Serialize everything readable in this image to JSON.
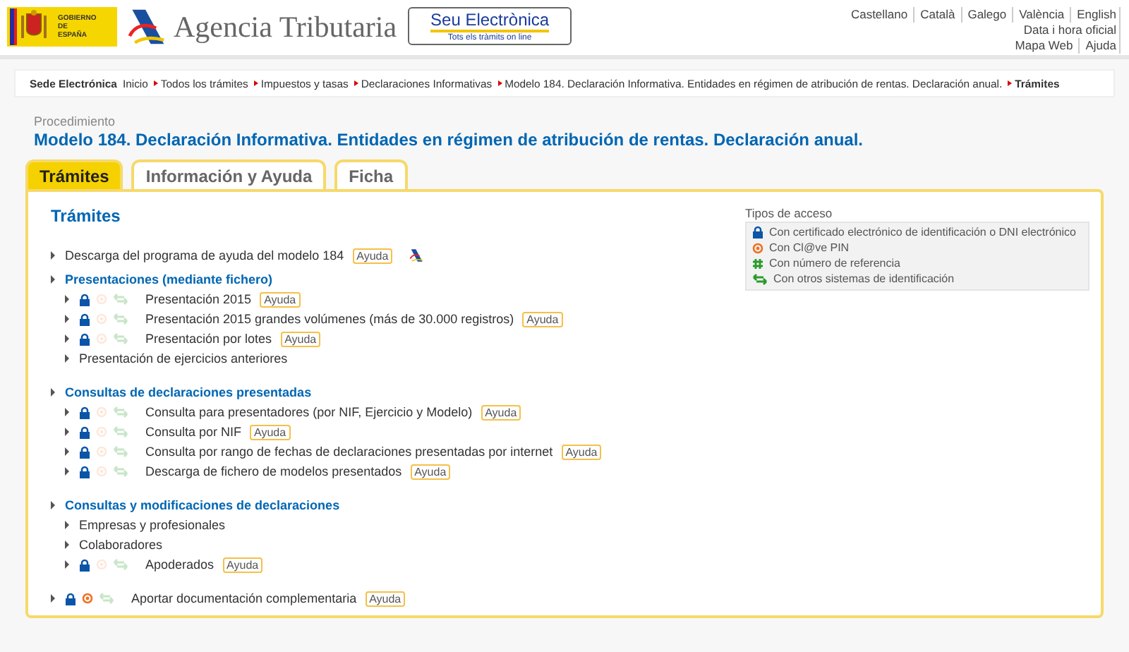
{
  "header": {
    "government": "GOBIERNO DE ESPAÑA",
    "agency": "Agencia Tributaria",
    "portal": {
      "title": "Seu Electrònica",
      "subtitle": "Tots els tràmits on line"
    },
    "languages": [
      "Castellano",
      "Català",
      "Galego",
      "València",
      "English"
    ],
    "links": [
      [
        "Data i hora oficial"
      ],
      [
        "Mapa Web",
        "Ajuda"
      ]
    ]
  },
  "breadcrumb": {
    "lead": "Sede Electrónica",
    "items": [
      "Inicio",
      "Todos los trámites",
      "Impuestos y tasas",
      "Declaraciones Informativas",
      "Modelo 184. Declaración Informativa. Entidades en régimen de atribución de rentas. Declaración anual.",
      "Trámites"
    ]
  },
  "procedure": {
    "label": "Procedimiento",
    "title": "Modelo 184. Declaración Informativa. Entidades en régimen de atribución de rentas. Declaración anual."
  },
  "tabs": [
    {
      "label": "Trámites",
      "selected": true
    },
    {
      "label": "Información y Ayuda",
      "selected": false
    },
    {
      "label": "Ficha",
      "selected": false
    }
  ],
  "section_title": "Trámites",
  "tree": [
    {
      "kind": "download",
      "label": "Descarga del programa de ayuda del modelo 184",
      "help": "Ayuda"
    },
    {
      "kind": "group",
      "label": "Presentaciones (mediante fichero)",
      "children": [
        {
          "kind": "item",
          "label": "Presentación 2015",
          "help": "Ayuda",
          "access": {
            "cert": true,
            "clave": false,
            "other": false
          }
        },
        {
          "kind": "item",
          "label": "Presentación 2015 grandes volúmenes (más de 30.000 registros)",
          "help": "Ayuda",
          "access": {
            "cert": true,
            "clave": false,
            "other": false
          }
        },
        {
          "kind": "item",
          "label": "Presentación por lotes",
          "help": "Ayuda",
          "access": {
            "cert": true,
            "clave": false,
            "other": false
          }
        },
        {
          "kind": "item",
          "label": "Presentación de ejercicios anteriores"
        }
      ]
    },
    {
      "kind": "group",
      "label": "Consultas de declaraciones presentadas",
      "children": [
        {
          "kind": "item",
          "label": "Consulta para presentadores (por NIF, Ejercicio y Modelo)",
          "help": "Ayuda",
          "access": {
            "cert": true,
            "clave": false,
            "other": false
          }
        },
        {
          "kind": "item",
          "label": "Consulta por NIF",
          "help": "Ayuda",
          "access": {
            "cert": true,
            "clave": false,
            "other": false
          }
        },
        {
          "kind": "item",
          "label": "Consulta por rango de fechas de declaraciones presentadas por internet",
          "help": "Ayuda",
          "access": {
            "cert": true,
            "clave": false,
            "other": false
          }
        },
        {
          "kind": "item",
          "label": "Descarga de fichero de modelos presentados",
          "help": "Ayuda",
          "access": {
            "cert": true,
            "clave": false,
            "other": false
          }
        }
      ]
    },
    {
      "kind": "group",
      "label": "Consultas y modificaciones de declaraciones",
      "children": [
        {
          "kind": "item",
          "label": "Empresas y profesionales"
        },
        {
          "kind": "item",
          "label": "Colaboradores"
        },
        {
          "kind": "item",
          "label": "Apoderados",
          "help": "Ayuda",
          "access": {
            "cert": true,
            "clave": false,
            "other": false
          }
        }
      ]
    },
    {
      "kind": "item",
      "label": "Aportar documentación complementaria",
      "help": "Ayuda",
      "access": {
        "cert": true,
        "clave": true,
        "other": false
      }
    }
  ],
  "access_legend": {
    "title": "Tipos de acceso",
    "items": [
      {
        "kind": "cert",
        "label": "Con certificado electrónico de identificación o DNI electrónico"
      },
      {
        "kind": "clave",
        "label": "Con Cl@ve PIN"
      },
      {
        "kind": "reference",
        "label": "Con número de referencia"
      },
      {
        "kind": "other",
        "label": "Con otros sistemas de identificación"
      }
    ]
  }
}
